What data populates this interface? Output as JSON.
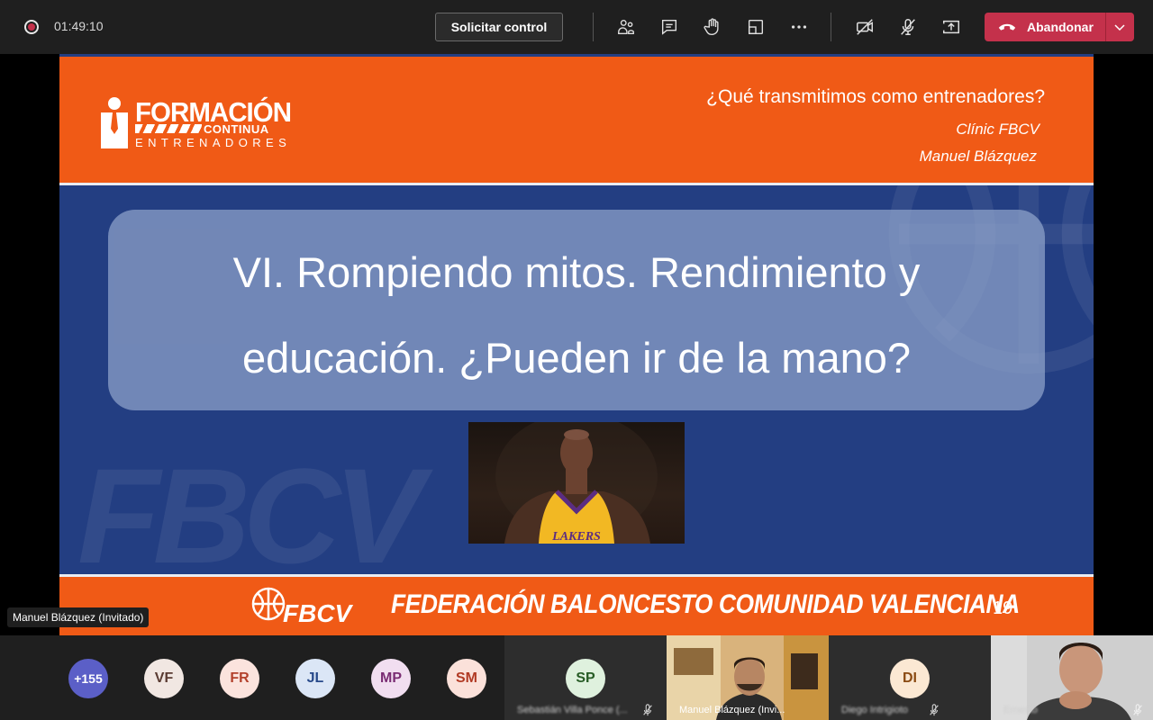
{
  "meeting": {
    "recording_time": "01:49:10",
    "request_control_label": "Solicitar control",
    "leave_label": "Abandonar",
    "colors": {
      "leave": "#c4314b",
      "bar": "#1f1f1f"
    }
  },
  "slide": {
    "logo": {
      "title": "FORMACIÓN",
      "subtitle": "CONTINUA",
      "subtitle2": "ENTRENADORES"
    },
    "header_title": "¿Qué transmitimos como entrenadores?",
    "clinic": "Clínic FBCV",
    "author": "Manuel Blázquez",
    "title_line1": "VI. Rompiendo mitos. Rendimiento y",
    "title_line2": "educación. ¿Pueden ir de la mano?",
    "jersey_text": "LAKERS",
    "footer_logo_text": "FBCV",
    "footer_text": "FEDERACIÓN BALONCESTO COMUNIDAD VALENCIANA",
    "page_number": "19",
    "colors": {
      "orange": "#f05a16",
      "blue": "#233e82"
    }
  },
  "presenter_label": "Manuel Blázquez (Invitado)",
  "participants": {
    "overflow_count": "+155",
    "avatars": [
      {
        "initials": "VF",
        "bg": "#f1e7e2",
        "fg": "#5a3b32"
      },
      {
        "initials": "FR",
        "bg": "#fbe3dd",
        "fg": "#b3402b"
      },
      {
        "initials": "JL",
        "bg": "#dbe6f6",
        "fg": "#27498a"
      },
      {
        "initials": "MP",
        "bg": "#f1def0",
        "fg": "#7a2c73"
      },
      {
        "initials": "SM",
        "bg": "#fbe1da",
        "fg": "#b13a24"
      }
    ],
    "tiles": [
      {
        "initials": "SP",
        "name": "Sebastián Villa Ponce (...",
        "bg": "#dff1de",
        "fg": "#275c25"
      },
      {
        "name": "Manuel Blázquez (Invi..."
      },
      {
        "initials": "DI",
        "name": "Diego Intrigioto",
        "bg": "#fbe8d3",
        "fg": "#8a4a12"
      },
      {
        "name": "Ernesto"
      }
    ]
  }
}
